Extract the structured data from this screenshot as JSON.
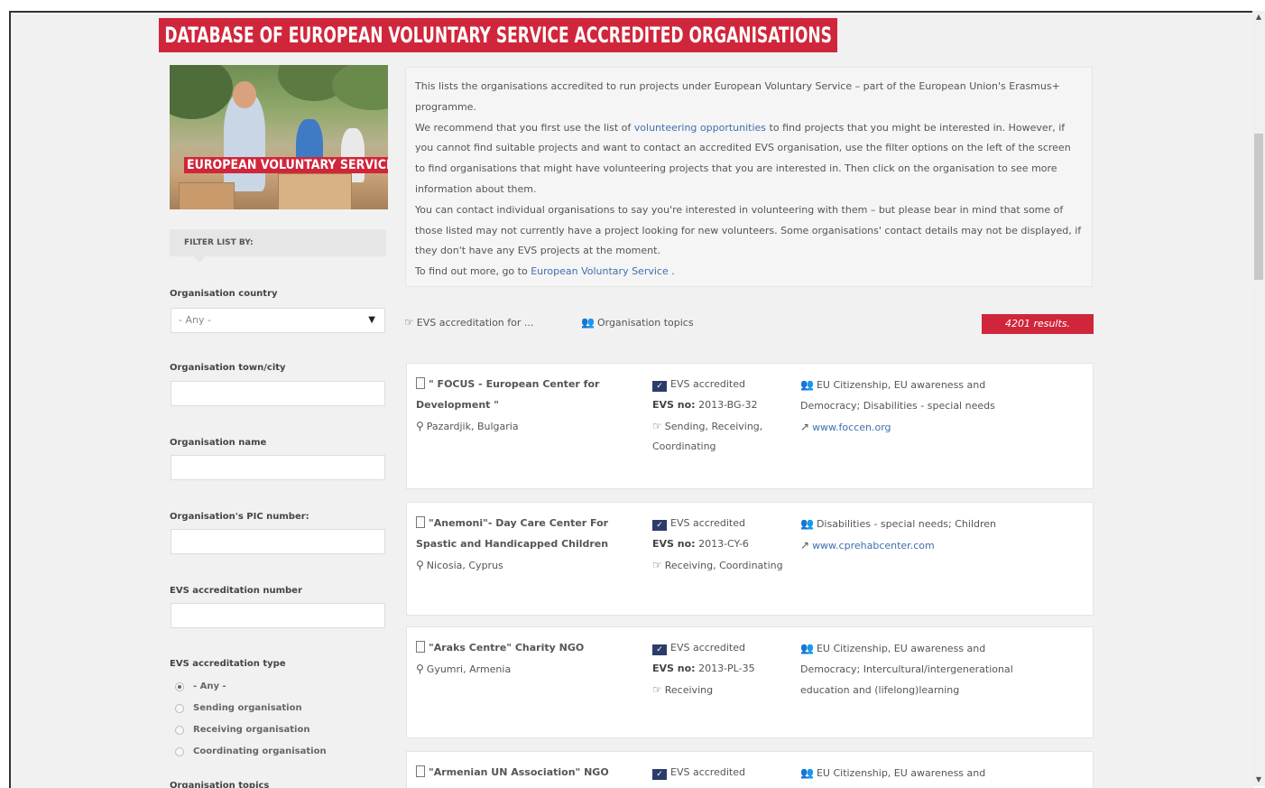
{
  "page": {
    "title": "DATABASE OF EUROPEAN VOLUNTARY SERVICE ACCREDITED ORGANISATIONS",
    "hero_label": "EUROPEAN VOLUNTARY SERVICE"
  },
  "colors": {
    "accent": "#d0263b",
    "link": "#3e6fb0",
    "background": "#f1f1f1"
  },
  "intro": {
    "p1": "This lists the organisations accredited to run projects under European Voluntary Service – part of the European Union's Erasmus+ programme.",
    "p2_before": "We recommend that you first use the list of ",
    "p2_link": "volunteering opportunities",
    "p2_after": " to find projects that you might be interested in. However, if you cannot find suitable projects and want to contact an accredited EVS organisation, use the filter options on the left of the screen to find organisations that might have volunteering projects that you are interested in. Then click on the organisation to see more information about them.",
    "p3": "You can contact individual organisations to say you're interested in volunteering with them – but please bear in mind that some of those listed may not currently have a project looking for new volunteers. Some organisations' contact details may not be displayed, if they don't have any EVS projects at the moment.",
    "p4_before": "To find out more, go to ",
    "p4_link": "European Voluntary Service",
    "p4_after": " ."
  },
  "filters": {
    "header": "FILTER LIST BY:",
    "country_label": "Organisation country",
    "country_value": "- Any -",
    "town_label": "Organisation town/city",
    "name_label": "Organisation name",
    "pic_label": "Organisation's PIC number:",
    "accnum_label": "EVS accreditation number",
    "acctype_label": "EVS accreditation type",
    "acctype_options": [
      "- Any -",
      "Sending organisation",
      "Receiving organisation",
      "Coordinating organisation"
    ],
    "topics_label": "Organisation topics"
  },
  "toolbar": {
    "accreditation_for": "EVS accreditation for ...",
    "topics": "Organisation topics",
    "results": "4201 results."
  },
  "results": [
    {
      "name": "\" FOCUS - European Center for Development \"",
      "location": "Pazardjik, Bulgaria",
      "accredited": "EVS accredited",
      "evs_no_label": "EVS no:",
      "evs_no": "2013-BG-32",
      "roles": "Sending, Receiving, Coordinating",
      "topics": "EU Citizenship, EU awareness and Democracy; Disabilities - special needs",
      "website": "www.foccen.org"
    },
    {
      "name": "\"Anemoni\"- Day Care Center For Spastic and Handicapped Children",
      "location": "Nicosia, Cyprus",
      "accredited": "EVS accredited",
      "evs_no_label": "EVS no:",
      "evs_no": "2013-CY-6",
      "roles": "Receiving, Coordinating",
      "topics": "Disabilities - special needs; Children",
      "website": "www.cprehabcenter.com"
    },
    {
      "name": "\"Araks Centre\" Charity NGO",
      "location": "Gyumri, Armenia",
      "accredited": "EVS accredited",
      "evs_no_label": "EVS no:",
      "evs_no": "2013-PL-35",
      "roles": "Receiving",
      "topics": "EU Citizenship, EU awareness and Democracy; Intercultural/intergenerational education and (lifelong)learning",
      "website": ""
    },
    {
      "name": "\"Armenian UN Association\" NGO",
      "location": "",
      "accredited": "EVS accredited",
      "evs_no_label": "",
      "evs_no": "",
      "roles": "",
      "topics": "EU Citizenship, EU awareness and",
      "website": ""
    }
  ]
}
